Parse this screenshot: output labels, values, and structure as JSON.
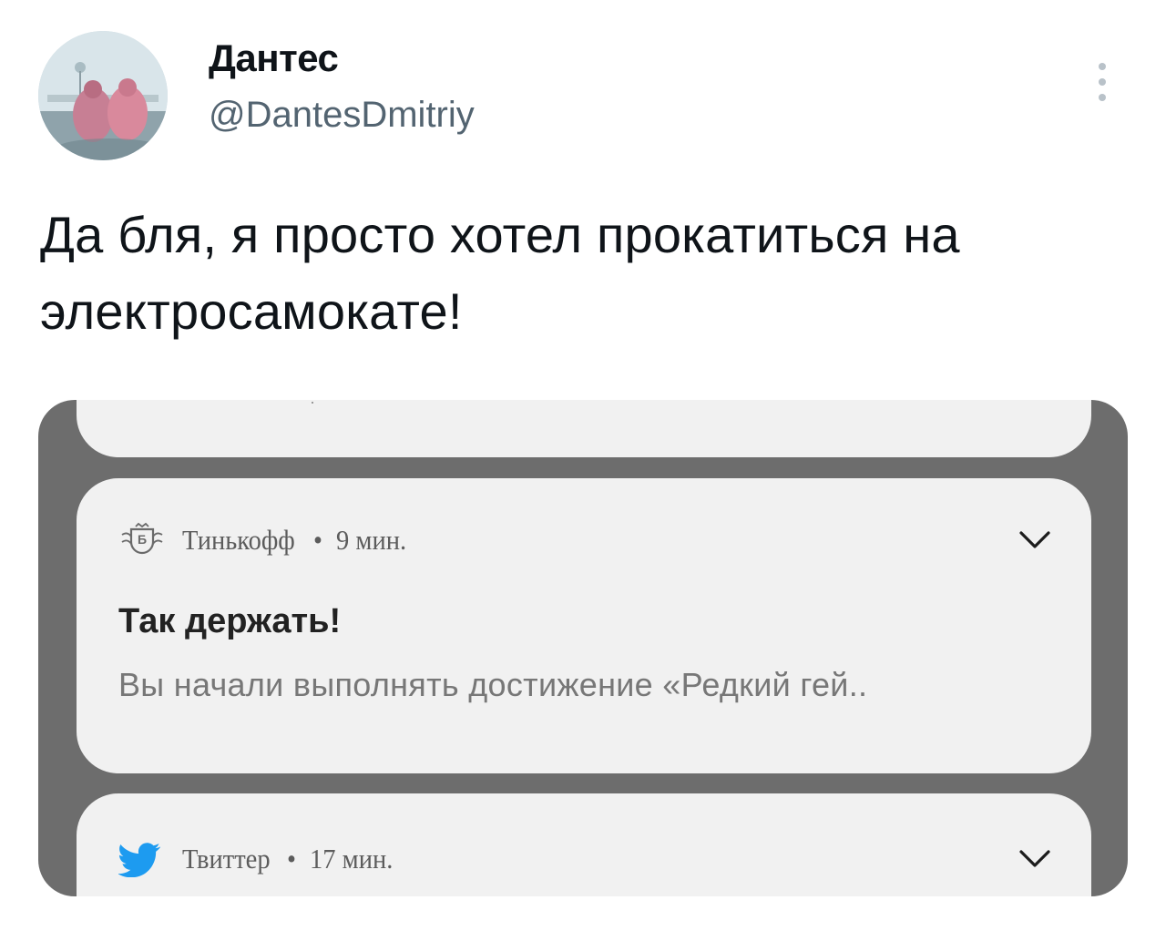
{
  "tweet": {
    "author_name": "Дантес",
    "author_handle": "@DantesDmitriy",
    "avatar_icon": "profile-photo",
    "more_icon": "vertical-ellipsis-icon",
    "text": "Да бля, я просто хотел прокатиться на электросамокате!"
  },
  "media": {
    "notifications": [
      {
        "app_icon": "tinkoff-logo-icon",
        "app_name": "Тинькофф",
        "separator": "•",
        "age": "9 мин.",
        "title": "Так держать!",
        "body": "Вы начали выполнять достижение «Редкий гей..",
        "expand_icon": "chevron-down-icon"
      },
      {
        "app_icon": "twitter-bird-icon",
        "app_name": "Твиттер",
        "separator": "•",
        "age": "17 мин.",
        "expand_icon": "chevron-down-icon"
      }
    ],
    "colors": {
      "backdrop": "#6d6d6d",
      "card": "#f1f1f1",
      "twitter_blue": "#1d9bf0"
    }
  }
}
